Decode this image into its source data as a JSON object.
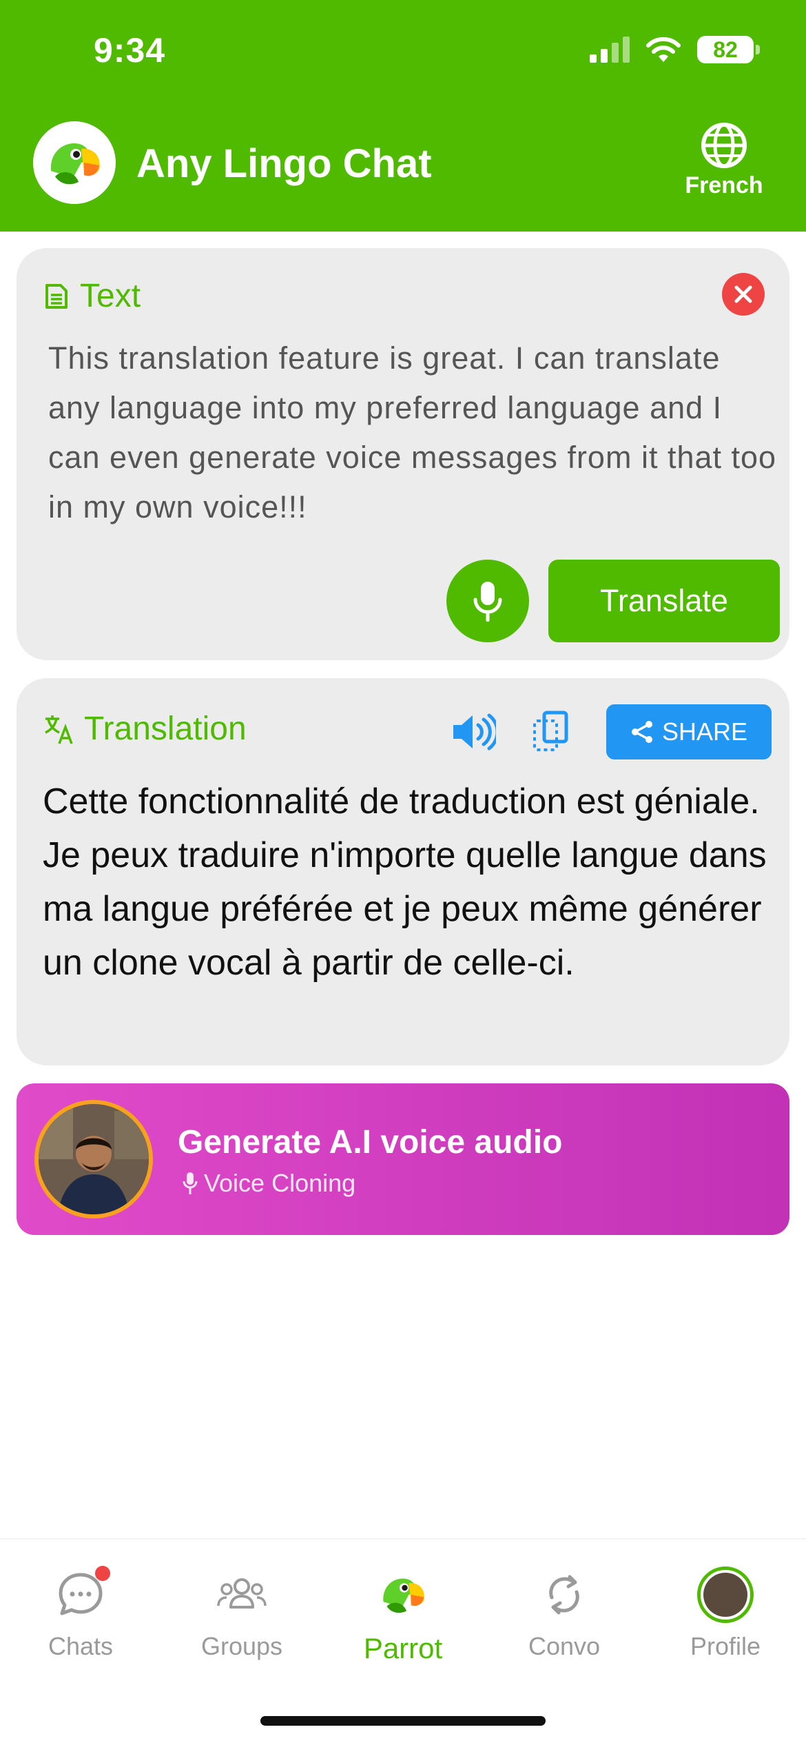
{
  "status_bar": {
    "time": "9:34",
    "battery": "82"
  },
  "header": {
    "title": "Any Lingo Chat",
    "language_label": "French",
    "colors": {
      "brand": "#4fba00"
    }
  },
  "text_card": {
    "heading": "Text",
    "input_text": "This translation feature is great. I can translate any language into my preferred language and I can even generate voice messages from it that too in my own voice!!!",
    "translate_label": "Translate",
    "icons": {
      "heading": "document-icon",
      "close": "close-icon",
      "mic": "microphone-icon"
    }
  },
  "translation_card": {
    "heading": "Translation",
    "share_label": "SHARE",
    "output_text": "Cette fonctionnalité de traduction est géniale. Je peux traduire n'importe quelle langue dans ma langue préférée et je peux même générer un clone vocal à partir de celle-ci.",
    "icons": {
      "heading": "translate-icon",
      "speaker": "speaker-icon",
      "copy": "copy-icon",
      "share": "share-icon"
    },
    "colors": {
      "share": "#2196f3"
    }
  },
  "voice_banner": {
    "title": "Generate A.I voice audio",
    "subtitle": "Voice Cloning"
  },
  "bottom_nav": {
    "items": [
      {
        "label": "Chats",
        "icon": "chat-bubble-icon",
        "active": false,
        "has_badge": true
      },
      {
        "label": "Groups",
        "icon": "groups-icon",
        "active": false
      },
      {
        "label": "Parrot",
        "icon": "parrot-logo-icon",
        "active": true
      },
      {
        "label": "Convo",
        "icon": "sync-arrows-icon",
        "active": false
      },
      {
        "label": "Profile",
        "icon": "profile-avatar-icon",
        "active": false
      }
    ]
  }
}
